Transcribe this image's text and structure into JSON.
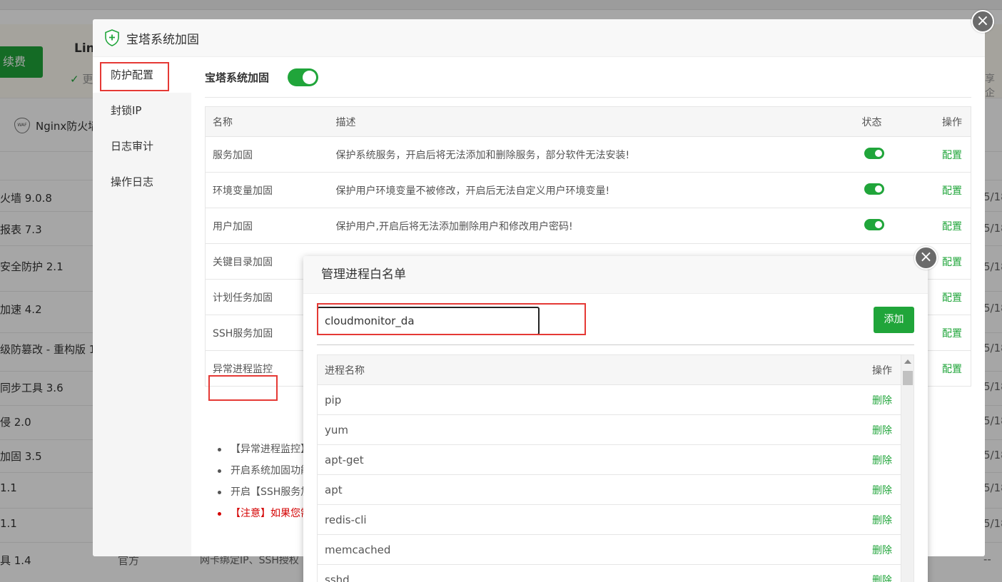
{
  "background": {
    "renew_label": "续费",
    "product_name": "Lin",
    "feature_hint": "更",
    "right_hint": "享企",
    "firewall_tab_label": "Nginx防火墙",
    "waf_badge": "WAF",
    "rows": [
      {
        "name": "火墙 9.0.8",
        "date": "5/18"
      },
      {
        "name": "报表 7.3",
        "date": "5/18"
      },
      {
        "name": "安全防护 2.1",
        "date": "5/18"
      },
      {
        "name": "加速 4.2",
        "date": "5/18"
      },
      {
        "name": "级防篡改 - 重构版 1",
        "date": "5/18"
      },
      {
        "name": "同步工具 3.6",
        "date": "5/18"
      },
      {
        "name": "侵 2.0",
        "date": "5/18"
      },
      {
        "name": "加固 3.5",
        "date": "5/18"
      },
      {
        "name": "1.1",
        "date": "5/18"
      },
      {
        "name": "1.1",
        "date": "5/18"
      },
      {
        "name": "具 1.4",
        "date": "--"
      }
    ],
    "last_row_type": "官方",
    "last_row_desc": "网卡绑定IP、SSH授权"
  },
  "dialog": {
    "title": "宝塔系统加固",
    "close_symbol": "×",
    "sidebar": [
      {
        "label": "防护配置"
      },
      {
        "label": "封锁IP"
      },
      {
        "label": "日志审计"
      },
      {
        "label": "操作日志"
      }
    ],
    "switch_label": "宝塔系统加固",
    "table": {
      "headers": {
        "name": "名称",
        "desc": "描述",
        "status": "状态",
        "op": "操作"
      },
      "rows": [
        {
          "name": "服务加固",
          "desc": "保护系统服务，开启后将无法添加和删除服务，部分软件无法安装!",
          "op": "配置"
        },
        {
          "name": "环境变量加固",
          "desc": "保护用户环境变量不被修改，开启后无法自定义用户环境变量!",
          "op": "配置"
        },
        {
          "name": "用户加固",
          "desc": "保护用户,开启后将无法添加删除用户和修改用户密码!",
          "op": "配置"
        },
        {
          "name": "关键目录加固",
          "desc": "",
          "op": "配置"
        },
        {
          "name": "计划任务加固",
          "desc": "",
          "op": "配置"
        },
        {
          "name": "SSH服务加固",
          "desc": "",
          "op": "配置"
        },
        {
          "name": "异常进程监控",
          "desc": "",
          "op": "配置"
        }
      ]
    },
    "notes": [
      "【异常进程监控】",
      "开启系统加固功能",
      "开启【SSH服务加",
      "【注意】如果您需"
    ]
  },
  "whitelist": {
    "title": "管理进程白名单",
    "close_symbol": "×",
    "input_value": "cloudmonitor_da",
    "add_label": "添加",
    "headers": {
      "name": "进程名称",
      "op": "操作"
    },
    "rows": [
      {
        "name": "pip",
        "op": "删除"
      },
      {
        "name": "yum",
        "op": "删除"
      },
      {
        "name": "apt-get",
        "op": "删除"
      },
      {
        "name": "apt",
        "op": "删除"
      },
      {
        "name": "redis-cli",
        "op": "删除"
      },
      {
        "name": "memcached",
        "op": "删除"
      },
      {
        "name": "sshd",
        "op": "删除"
      }
    ]
  },
  "colors": {
    "accent": "#20a53a",
    "highlight": "#e53935",
    "warning": "#d40000"
  }
}
